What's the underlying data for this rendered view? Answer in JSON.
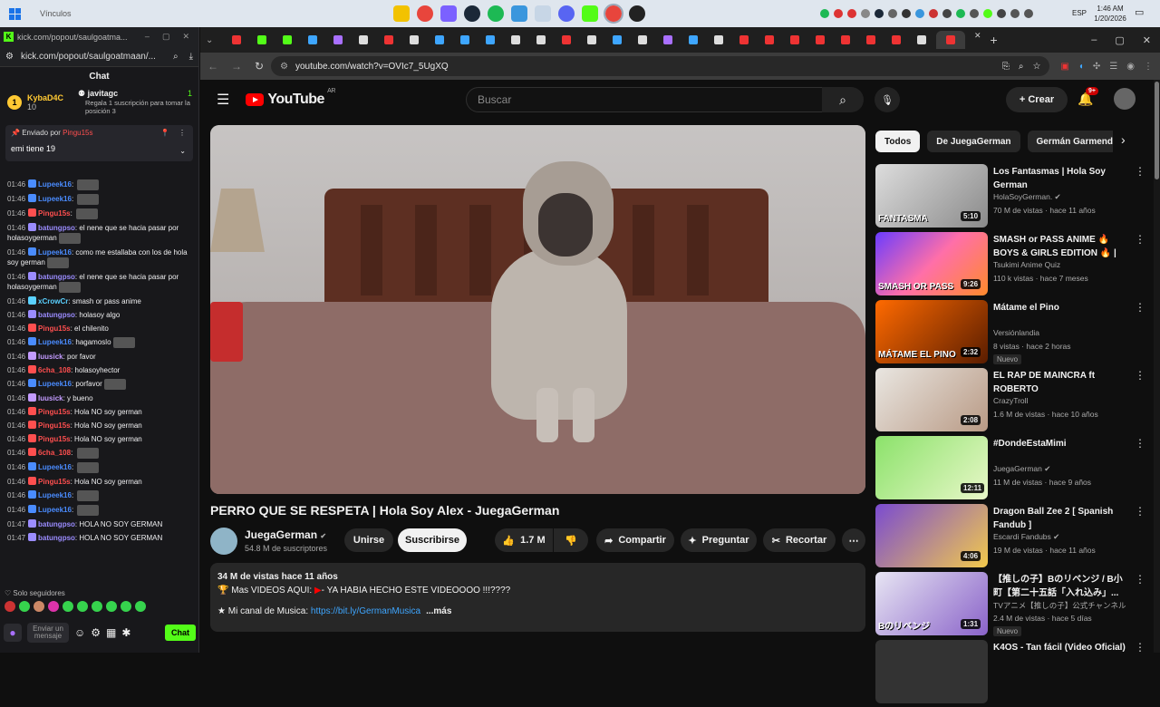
{
  "taskbar": {
    "window_title": "Vínculos",
    "lang": "ESP",
    "time": "1:46 AM",
    "date": "1/20/2026"
  },
  "twitch": {
    "tab_title": "kick.com/popout/saulgoatma...",
    "url": "kick.com/popout/saulgoatmaan/...",
    "chat_header": "Chat",
    "gift": {
      "rank": "1",
      "user": "KybaD4C",
      "count": "10",
      "target_user": "javitagc",
      "target_rank": "1",
      "note": "Regala 1 suscripción para tomar la posición 3"
    },
    "pinned": {
      "by_label": "Enviado por",
      "by_user": "Pingu15s",
      "text": "emi tiene 19"
    },
    "messages": [
      {
        "t": "01:46",
        "u": "Lupeek16",
        "c": "#4a8cff",
        "m": "",
        "emote": true
      },
      {
        "t": "01:46",
        "u": "Lupeek16",
        "c": "#4a8cff",
        "m": "",
        "emote": true
      },
      {
        "t": "01:46",
        "u": "Pingu15s",
        "c": "#ff4f4f",
        "m": "",
        "emote": true
      },
      {
        "t": "01:46",
        "u": "batungpso",
        "c": "#9b8cff",
        "m": "el nene que se hacia pasar por holasoygerman",
        "emote": true
      },
      {
        "t": "01:46",
        "u": "Lupeek16",
        "c": "#4a8cff",
        "m": "como me estallaba con los de hola soy german",
        "emote": true
      },
      {
        "t": "01:46",
        "u": "batungpso",
        "c": "#9b8cff",
        "m": "el nene que se hacia pasar por holasoygerman",
        "emote": true
      },
      {
        "t": "01:46",
        "u": "xCrowCr",
        "c": "#5ad1ff",
        "m": "smash or pass anime",
        "emote": false
      },
      {
        "t": "01:46",
        "u": "batungpso",
        "c": "#9b8cff",
        "m": "holasoy algo",
        "emote": false
      },
      {
        "t": "01:46",
        "u": "Pingu15s",
        "c": "#ff4f4f",
        "m": "el chilenito",
        "emote": false
      },
      {
        "t": "01:46",
        "u": "Lupeek16",
        "c": "#4a8cff",
        "m": "hagamoslo",
        "emote": true
      },
      {
        "t": "01:46",
        "u": "luusick",
        "c": "#c39bff",
        "m": "por favor",
        "emote": false
      },
      {
        "t": "01:46",
        "u": "6cha_108",
        "c": "#ff4f4f",
        "m": "holasoyhector",
        "emote": false
      },
      {
        "t": "01:46",
        "u": "Lupeek16",
        "c": "#4a8cff",
        "m": "porfavor",
        "emote": true
      },
      {
        "t": "01:46",
        "u": "luusick",
        "c": "#c39bff",
        "m": "y bueno",
        "emote": false
      },
      {
        "t": "01:46",
        "u": "Pingu15s",
        "c": "#ff4f4f",
        "m": "Hola NO soy german",
        "emote": false
      },
      {
        "t": "01:46",
        "u": "Pingu15s",
        "c": "#ff4f4f",
        "m": "Hola NO soy german",
        "emote": false
      },
      {
        "t": "01:46",
        "u": "Pingu15s",
        "c": "#ff4f4f",
        "m": "Hola NO soy german",
        "emote": false
      },
      {
        "t": "01:46",
        "u": "6cha_108",
        "c": "#ff4f4f",
        "m": "",
        "emote": true
      },
      {
        "t": "01:46",
        "u": "Lupeek16",
        "c": "#4a8cff",
        "m": "",
        "emote": true
      },
      {
        "t": "01:46",
        "u": "Pingu15s",
        "c": "#ff4f4f",
        "m": "Hola NO soy german",
        "emote": false
      },
      {
        "t": "01:46",
        "u": "Lupeek16",
        "c": "#4a8cff",
        "m": "",
        "emote": true
      },
      {
        "t": "01:46",
        "u": "Lupeek16",
        "c": "#4a8cff",
        "m": "",
        "emote": true
      },
      {
        "t": "01:47",
        "u": "batungpso",
        "c": "#9b8cff",
        "m": "HOLA NO SOY GERMAN",
        "emote": false
      },
      {
        "t": "01:47",
        "u": "batungpso",
        "c": "#9b8cff",
        "m": "HOLA NO SOY GERMAN",
        "emote": false
      }
    ],
    "followers_only": "Solo seguidores",
    "input_placeholder": "Enviar un mensaje",
    "chat_button": "Chat"
  },
  "chrome": {
    "url": "youtube.com/watch?v=OVIc7_5UgXQ"
  },
  "youtube": {
    "logo": "YouTube",
    "region": "AR",
    "search_placeholder": "Buscar",
    "create_label": "Crear",
    "notif_badge": "9+",
    "video_title": "PERRO QUE SE RESPETA | Hola Soy Alex - JuegaGerman",
    "channel_name": "JuegaGerman",
    "subscribers": "54.8 M de suscriptores",
    "join_label": "Unirse",
    "subscribe_label": "Suscribirse",
    "likes": "1.7 M",
    "share_label": "Compartir",
    "ask_label": "Preguntar",
    "clip_label": "Recortar",
    "desc_stats": "34 M de vistas  hace 11 años",
    "desc_line2": "Mas VIDEOS AQUI:",
    "desc_line2b": "- YA HABIA HECHO ESTE VIDEOOOO !!!????",
    "desc_line3": "Mi canal de Musica:",
    "desc_link": "https://bit.ly/GermanMusica",
    "desc_more": "...más",
    "chips": [
      "Todos",
      "De JuegaGerman",
      "Germán Garmendia"
    ],
    "recs": [
      {
        "title": "Los Fantasmas | Hola Soy German",
        "channel": "HolaSoyGerman.",
        "verified": true,
        "meta": "70 M de vistas · hace 11 años",
        "dur": "5:10",
        "new": "",
        "bg": "linear-gradient(135deg,#ddd,#8a8a8a)",
        "label": "FANTASMA"
      },
      {
        "title": "SMASH or PASS ANIME 🔥 BOYS & GIRLS EDITION 🔥 | ...",
        "channel": "Tsukimi Anime Quiz",
        "verified": false,
        "meta": "110 k vistas · hace 7 meses",
        "dur": "9:26",
        "new": "",
        "bg": "linear-gradient(135deg,#6a3cff,#ff6fa8,#ff8a2b)",
        "label": "SMASH OR PASS"
      },
      {
        "title": "Mátame el Pino",
        "channel": "Versiónlandia",
        "verified": false,
        "meta": "8 vistas · hace 2 horas",
        "dur": "2:32",
        "new": "Nuevo",
        "bg": "linear-gradient(135deg,#ff6a00,#5a1d00)",
        "label": "MÁTAME EL PINO"
      },
      {
        "title": "EL RAP DE MAINCRA ft ROBERTO",
        "channel": "CrazyTroll",
        "verified": false,
        "meta": "1.6 M de vistas · hace 10 años",
        "dur": "2:08",
        "new": "",
        "bg": "linear-gradient(135deg,#e9e6e1,#b99a85)",
        "label": ""
      },
      {
        "title": "#DondeEstaMimi",
        "channel": "JuegaGerman",
        "verified": true,
        "meta": "11 M de vistas · hace 9 años",
        "dur": "12:11",
        "new": "",
        "bg": "linear-gradient(135deg,#8be26a,#e8f7c8)",
        "label": ""
      },
      {
        "title": "Dragon Ball Zee 2 [ Spanish Fandub ]",
        "channel": "Escardi Fandubs",
        "verified": true,
        "meta": "19 M de vistas · hace 11 años",
        "dur": "4:06",
        "new": "",
        "bg": "linear-gradient(135deg,#7a4bd1,#f2c94c)",
        "label": ""
      },
      {
        "title": "【推しの子】Bのリベンジ / B小町【第二十五話「入れ込み」...",
        "channel": "TVアニメ【推しの子】公式チャンネル",
        "verified": false,
        "meta": "2.4 M de vistas · hace 5 días",
        "dur": "1:31",
        "new": "Nuevo",
        "bg": "linear-gradient(135deg,#e7e5f3,#8a63c9)",
        "label": "Bのリベンジ"
      },
      {
        "title": "K4OS - Tan fácil (Video Oficial)",
        "channel": "",
        "verified": false,
        "meta": "",
        "dur": "",
        "new": "",
        "bg": "#333",
        "label": ""
      }
    ]
  }
}
